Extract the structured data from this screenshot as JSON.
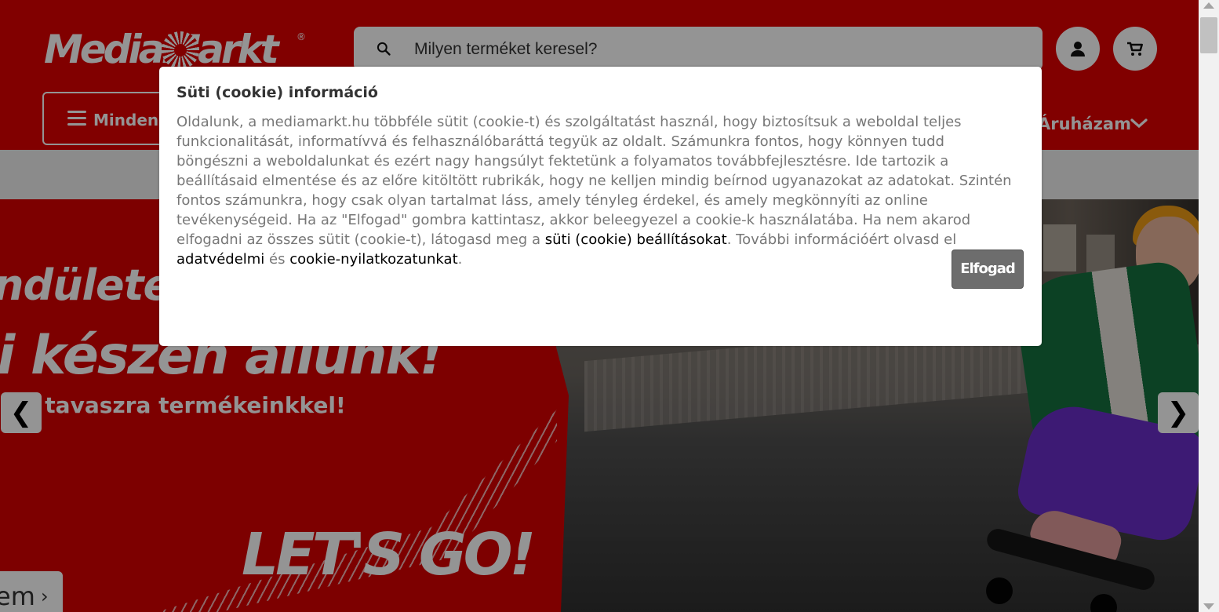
{
  "brand": {
    "logo_text": "MediaMarkt",
    "trademark": "®"
  },
  "colors": {
    "header_red": "#df0000",
    "hero_red": "#d70000",
    "button_gray": "#6d6d6d"
  },
  "header": {
    "search_placeholder": "Milyen terméket keresel?",
    "menu_label": "Minden k",
    "store_label": "Áruházam",
    "icons": [
      "search-icon",
      "account-icon",
      "cart-icon",
      "chevron-down-icon"
    ]
  },
  "hero": {
    "line1": "ndületet v",
    "line2": "i készen állunk!",
    "line3": "á a tavaszra termékeinkkel!",
    "slogan": "LET'S GO!",
    "prev_label": "❮",
    "next_label": "❯",
    "more_label": "em",
    "more_chevron": "›"
  },
  "cookie_modal": {
    "title": "Süti (cookie) információ",
    "body_intro": "Oldalunk, a mediamarkt.hu többféle sütit (cookie-t) és szolgáltatást használ, hogy biztosítsuk a weboldal teljes funkcionalitását, informatívvá és felhasználóbaráttá tegyük az oldalt. Számunkra fontos, hogy könnyen tudd böngészni a weboldalunkat és ezért nagy hangsúlyt fektetünk a folyamatos továbbfejlesztésre. Ide tartozik a beállításaid elmentése és az előre kitöltött rubrikák, hogy ne kelljen mindig beírnod ugyanazokat az adatokat. Szintén fontos számunkra, hogy csak olyan tartalmat láss, amely tényleg érdekel, és amely megkönnyíti az online tevékenységeid. Ha az \"Elfogad\" gombra kattintasz, akkor beleegyezel a cookie-k használatába. Ha nem akarod elfogadni az összes sütit (cookie-t), látogasd meg a",
    "settings_link": "süti (cookie) beállításokat",
    "after_settings": ". További információért olvasd el ",
    "privacy_link": "adatvédelmi",
    "and": " és ",
    "cookie_statement_link": "cookie-nyilatkozatunkat",
    "period": ".",
    "accept_label": "Elfogad"
  },
  "scrollbar": {
    "up_icon": "scroll-up-arrow-icon",
    "down_icon": "scroll-down-arrow-icon"
  }
}
